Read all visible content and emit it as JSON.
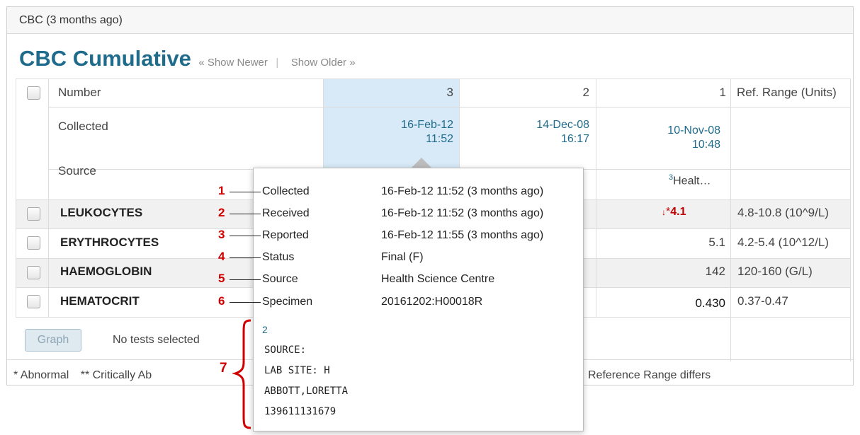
{
  "panel": {
    "header_name": "CBC",
    "header_age": "(3 months ago)",
    "title": "CBC Cumulative",
    "show_newer": "« Show Newer",
    "separator": "|",
    "show_older": "Show Older »"
  },
  "table": {
    "row_labels": {
      "number": "Number",
      "collected": "Collected",
      "source": "Source"
    },
    "ref_header": "Ref. Range (Units)",
    "columns": [
      {
        "number": "3",
        "date": "16-Feb-12",
        "time": "11:52"
      },
      {
        "number": "2",
        "date": "14-Dec-08",
        "time": "16:17"
      },
      {
        "number": "1",
        "date": "10-Nov-08",
        "time": "10:48",
        "source_sup": "3",
        "source": "Healt…"
      }
    ],
    "tests": [
      {
        "name": "LEUKOCYTES",
        "value": "4.1",
        "flag": "*",
        "flag_arrow": "↓",
        "ref": "4.8-10.8 (10^9/L)"
      },
      {
        "name": "ERYTHROCYTES",
        "value": "5.1",
        "ref": "4.2-5.4 (10^12/L)"
      },
      {
        "name": "HAEMOGLOBIN",
        "value": "142",
        "ref": "120-160 (G/L)"
      },
      {
        "name": "HEMATOCRIT",
        "value": "0.430",
        "ref": "0.37-0.47"
      }
    ]
  },
  "actions": {
    "graph_label": "Graph",
    "no_tests": "No tests selected"
  },
  "footer": {
    "abnormal": "* Abnormal",
    "critical": "** Critically Ab",
    "ref_differs": "Reference Range differs"
  },
  "popup": {
    "fields": [
      {
        "num": "1",
        "label": "Collected",
        "value": "16-Feb-12 11:52 (3 months ago)"
      },
      {
        "num": "2",
        "label": "Received",
        "value": "16-Feb-12 11:52 (3 months ago)"
      },
      {
        "num": "3",
        "label": "Reported",
        "value": "16-Feb-12 11:55 (3 months ago)"
      },
      {
        "num": "4",
        "label": "Status",
        "value": "Final (F)"
      },
      {
        "num": "5",
        "label": "Source",
        "value": "Health Science Centre"
      },
      {
        "num": "6",
        "label": "Specimen",
        "value": "20161202:H00018R"
      }
    ],
    "note_index": "2",
    "note_num": "7",
    "note_lines": [
      "SOURCE:",
      "LAB SITE: H",
      "ABBOTT,LORETTA",
      "139611131679"
    ]
  },
  "colors": {
    "title": "#1f6b8c",
    "link": "#1f6b8c",
    "highlight": "#d8eaf7",
    "abnormal": "#c00000",
    "annotation": "#d00000"
  }
}
